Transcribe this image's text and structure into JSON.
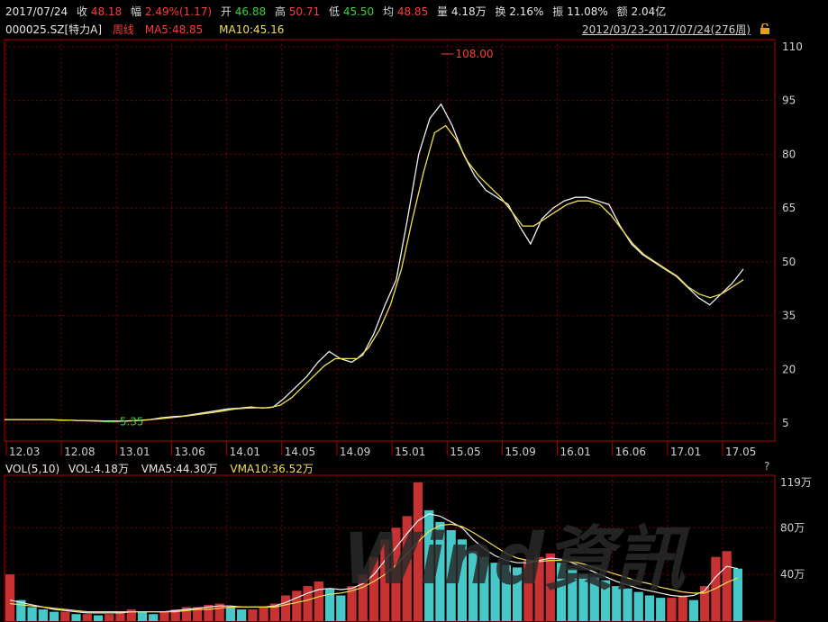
{
  "header": {
    "date": "2017/07/24",
    "close_label": "收",
    "close_value": "48.18",
    "change_label": "幅",
    "change_value": "2.49%(1.17)",
    "open_label": "开",
    "open_value": "46.88",
    "high_label": "高",
    "high_value": "50.71",
    "low_label": "低",
    "low_value": "45.50",
    "avg_label": "均",
    "avg_value": "48.85",
    "volume_label": "量",
    "volume_value": "4.18万",
    "turnover_label": "换",
    "turnover_value": "2.16%",
    "amplitude_label": "振",
    "amplitude_value": "11.08%",
    "amount_label": "额",
    "amount_value": "2.04亿"
  },
  "info": {
    "code": "000025.SZ",
    "name": "[特力A]",
    "period": "周线",
    "ma5": "MA5:48.85",
    "ma10": "MA10:45.16",
    "range": "2012/03/23-2017/07/24(276周)"
  },
  "colors": {
    "up": "#ff3b3b",
    "down": "#3cd03c",
    "ma5": "#f0f0f0",
    "ma10": "#f0e050",
    "grid": "#7a0000",
    "axis": "#b00000",
    "vol_up": "#c83232",
    "vol_down": "#46c8c8"
  },
  "chart_data": [
    {
      "type": "line",
      "title": "",
      "y_ticks": [
        110,
        95,
        80,
        65,
        50,
        35,
        20,
        5
      ],
      "ylim": [
        0,
        112
      ],
      "x_tick_labels": [
        "12.03",
        "12.08",
        "13.01",
        "13.06",
        "14.01",
        "14.05",
        "14.09",
        "15.01",
        "15.05",
        "15.09",
        "16.01",
        "16.06",
        "17.01",
        "17.05"
      ],
      "annotations": [
        {
          "text": "108.00",
          "type": "max"
        },
        {
          "text": "5.35",
          "type": "min"
        }
      ],
      "series": [
        {
          "name": "MA5",
          "values": [
            6,
            6,
            6,
            6,
            6,
            5.8,
            5.8,
            5.7,
            5.6,
            5.5,
            5.5,
            5.6,
            5.8,
            6,
            6.5,
            6.8,
            7,
            7.5,
            8,
            8.5,
            9,
            9.2,
            9.5,
            9.2,
            9.5,
            12,
            15,
            18,
            22,
            25,
            23,
            22,
            24,
            30,
            38,
            45,
            62,
            80,
            90,
            94,
            88,
            80,
            74,
            70,
            68,
            66,
            60,
            55,
            62,
            65,
            67,
            68,
            68,
            67,
            66,
            60,
            55,
            52,
            50,
            48,
            46,
            43,
            40,
            38,
            41,
            44,
            48
          ]
        },
        {
          "name": "MA10",
          "values": [
            6,
            6,
            6,
            6,
            6,
            5.9,
            5.8,
            5.7,
            5.7,
            5.6,
            5.6,
            5.6,
            5.7,
            5.9,
            6.2,
            6.5,
            6.8,
            7.2,
            7.6,
            8,
            8.5,
            9,
            9.2,
            9.3,
            9.3,
            10,
            12,
            15,
            18,
            21,
            23,
            23,
            23,
            26,
            31,
            38,
            48,
            62,
            75,
            86,
            88,
            84,
            78,
            74,
            71,
            68,
            64,
            60,
            60,
            62,
            64,
            66,
            67,
            67,
            66,
            63,
            59,
            55,
            52,
            50,
            48,
            46,
            43,
            41,
            40,
            41,
            43,
            45
          ]
        }
      ]
    },
    {
      "type": "bar",
      "title": "",
      "y_ticks": [
        "119万",
        "80万",
        "40万"
      ],
      "ylim": [
        0,
        125
      ],
      "legend": [
        "VOL(5,10)",
        "VOL:4.18万",
        "VMA5:44.30万",
        "VMA10:36.52万"
      ],
      "series": [
        {
          "name": "VOL",
          "values": [
            40,
            18,
            12,
            10,
            8,
            8,
            6,
            6,
            5,
            6,
            8,
            10,
            8,
            6,
            8,
            10,
            12,
            12,
            14,
            15,
            12,
            10,
            10,
            12,
            15,
            22,
            26,
            30,
            34,
            28,
            22,
            30,
            40,
            55,
            70,
            80,
            90,
            119,
            95,
            85,
            78,
            70,
            60,
            55,
            50,
            48,
            46,
            52,
            55,
            58,
            50,
            45,
            40,
            38,
            35,
            30,
            28,
            25,
            22,
            20,
            20,
            22,
            18,
            30,
            55,
            60,
            45
          ]
        },
        {
          "name": "VMA5",
          "values": [
            18,
            16,
            14,
            12,
            10,
            9,
            8,
            7,
            7,
            7,
            7,
            8,
            8,
            8,
            8,
            9,
            10,
            11,
            12,
            13,
            13,
            12,
            12,
            12,
            13,
            16,
            20,
            24,
            27,
            28,
            27,
            28,
            32,
            40,
            52,
            63,
            75,
            86,
            92,
            90,
            85,
            80,
            70,
            62,
            56,
            52,
            50,
            50,
            52,
            54,
            53,
            50,
            46,
            42,
            38,
            34,
            31,
            28,
            26,
            24,
            22,
            21,
            22,
            26,
            38,
            47,
            45
          ]
        },
        {
          "name": "VMA10",
          "values": [
            15,
            14,
            13,
            12,
            11,
            10,
            9,
            8,
            8,
            8,
            8,
            8,
            8,
            8,
            8,
            8,
            9,
            10,
            10,
            11,
            12,
            12,
            12,
            12,
            12,
            14,
            16,
            18,
            21,
            23,
            24,
            26,
            29,
            34,
            40,
            48,
            58,
            68,
            77,
            82,
            83,
            81,
            76,
            70,
            64,
            58,
            54,
            52,
            51,
            52,
            52,
            51,
            49,
            46,
            43,
            40,
            37,
            34,
            32,
            29,
            27,
            25,
            24,
            24,
            28,
            33,
            37
          ]
        }
      ]
    }
  ],
  "watermark": "Wind資訊"
}
